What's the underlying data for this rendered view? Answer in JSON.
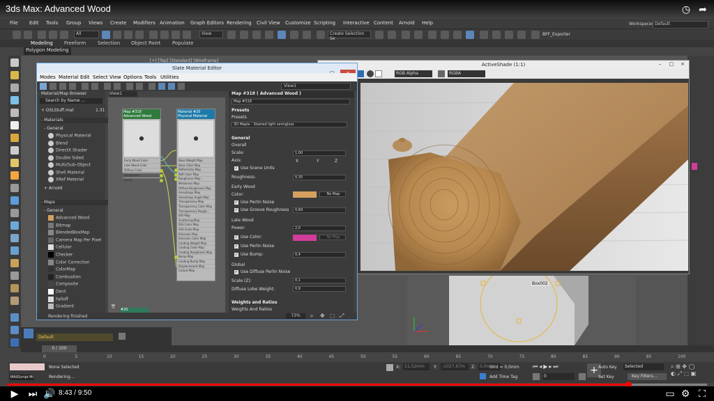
{
  "video": {
    "title": "3ds Max: Advanced Wood",
    "time": "8:43 / 9:50",
    "progress_fraction": 0.887
  },
  "max": {
    "menu": [
      "File",
      "Edit",
      "Tools",
      "Group",
      "Views",
      "Create",
      "Modifiers",
      "Animation",
      "Graph Editors",
      "Rendering",
      "Civil View",
      "Customize",
      "Scripting",
      "Interactive",
      "Content",
      "Arnold",
      "Help"
    ],
    "workspaces_label": "Workspaces:",
    "workspace_value": "Default",
    "toolbar_all": "All",
    "toolbar_view": "View",
    "create_selection": "Create Selection Se",
    "bff_exporter": "BFF_Exporter",
    "ribbon_tabs": [
      "Modeling",
      "Freeform",
      "Selection",
      "Object Paint",
      "Populate"
    ],
    "polygon_modeling": "Polygon Modeling",
    "layer_default": "Default",
    "frame_counter": "0 / 100",
    "timeline_ticks": [
      "0",
      "5",
      "10",
      "15",
      "20",
      "25",
      "30",
      "35",
      "40",
      "45",
      "50",
      "55",
      "60",
      "65",
      "70",
      "75",
      "80",
      "85",
      "90",
      "95",
      "100"
    ],
    "status_none_selected": "None Selected",
    "status_rendering": "Rendering...",
    "maxscript": "MAXScript Mi",
    "coord_x": "X:",
    "coord_y": "Y:",
    "coord_z": "Z:",
    "coord_x_val": "11,52mm",
    "coord_y_val": "-1027,67m",
    "coord_z_val": "0,0mm",
    "grid": "Grid = 0,0mm",
    "add_time_tag": "Add Time Tag",
    "auto_key": "Auto Key",
    "selected": "Selected",
    "set_key": "Set Key",
    "key_filters": "Key Filters...",
    "current_frame": "0",
    "viewport_label": "[+] [Top] [Standard] [Wireframe]",
    "box_label": "Box002"
  },
  "slate": {
    "title": "Slate Material Editor",
    "menu": [
      "Modes",
      "Material",
      "Edit",
      "Select",
      "View",
      "Options",
      "Tools",
      "Utilities"
    ],
    "view_dropdown": "View1",
    "browser": {
      "title": "Material/Map Browser",
      "search": "Search by Name ...",
      "osl_file": "+ OSLStuff.mat",
      "osl_count": "1.31",
      "materials_head": "- Materials",
      "general_head": "- General",
      "materials": [
        "Physical Material",
        "Blend",
        "DirectX Shader",
        "Double Sided",
        "Multi/Sub-Object",
        "Shell Material",
        "XRef Material"
      ],
      "arnold": "+ Arnold",
      "maps_head": "- Maps",
      "maps_general": "- General",
      "maps": [
        "Advanced Wood",
        "Bitmap",
        "BlendedBoxMap",
        "Camera Map Per Pixel",
        "Cellular",
        "Checker",
        "Color Correction",
        "ColorMap",
        "Combustion",
        "Composite",
        "Dent",
        "Falloff",
        "Gradient"
      ]
    },
    "view_tab": "View1",
    "node1": {
      "title": "Map #318",
      "subtitle": "Advanced Wood",
      "slots": [
        "Early Wood Color",
        "Late Wood Color",
        "Diffuse Color",
        "Roughness",
        "Bump"
      ]
    },
    "node2": {
      "title": "Material #20",
      "subtitle": "Physical Material",
      "slots": [
        "Base Weight Map",
        "Base Color Map",
        "Reflectivity Map",
        "Refl Color Map",
        "Roughness Map",
        "Metalness Map",
        "Diffuse Roughness Map",
        "Anisotropy Map",
        "Anisotropy Angle Map",
        "Transparency Map",
        "Transparency Color Map",
        "Transparency Rough...",
        "IOR Map",
        "Scattering Map",
        "SSS Color Map",
        "SSS Scale Map",
        "Emission Map",
        "Emission Color Map",
        "Coating Weight Map",
        "Coating Color Map",
        "Coating Roughness Map",
        "Bump Map",
        "Coating Bump Map",
        "Displacement Map",
        "Cutout Map"
      ]
    },
    "node3_label": "#20",
    "params": {
      "header": "Map #318  ( Advanced Wood )",
      "map_name": "Map #318",
      "presets_head": "Presets",
      "presets_label": "Presets",
      "preset_value": "3D Maple - Stained light semigloss",
      "general_head": "General",
      "overall": "Overall",
      "scale_label": "Scale:",
      "scale_value": "1,00",
      "axis_label": "Axis:",
      "axis_x": "X",
      "axis_y": "Y",
      "axis_z": "Z",
      "use_scene_units": "Use Scene Units",
      "roughness_label": "Roughness:",
      "roughness_value": "0,35",
      "early_wood": "Early Wood",
      "color_label": "Color:",
      "no_map": "No Map",
      "early_color": "#d4a060",
      "use_perlin": "Use Perlin Noise",
      "use_groove": "Use Groove Roughness",
      "groove_value": "0,69",
      "late_wood": "Late Wood",
      "power_label": "Power:",
      "power_value": "2,0",
      "use_color": "Use Color:",
      "late_color": "#d23c9a",
      "use_perlin2": "Use Perlin Noise",
      "use_bump": "Use Bump:",
      "bump_value": "0,4",
      "global": "Global",
      "use_diffuse_perlin": "Use Diffuse Perlin Noise",
      "scale_z_label": "Scale (Z):",
      "scale_z_value": "0,1",
      "diffuse_lobe_label": "Diffuse Lobe Weight:",
      "diffuse_lobe_value": "0,9",
      "weights_head": "Weights and Ratios",
      "weights_sub": "Weights And Ratios"
    },
    "status": "Rendering finished",
    "zoom": "73%"
  },
  "activeshade": {
    "title": "ActiveShade (1:1)",
    "channel": "RGB Alpha",
    "display": "RGBA"
  }
}
